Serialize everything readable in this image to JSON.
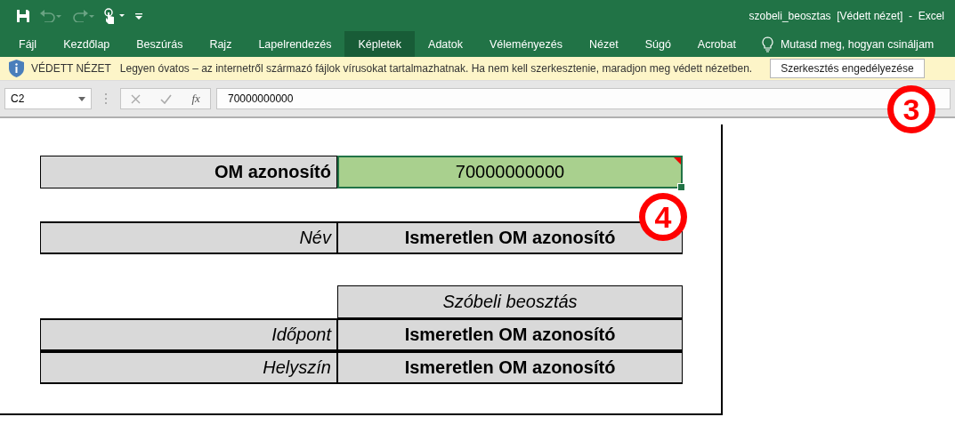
{
  "window": {
    "title": "szobeli_beosztas  [Védett nézet]  -  Excel"
  },
  "tabs": [
    {
      "label": "Fájl",
      "selected": false
    },
    {
      "label": "Kezdőlap",
      "selected": false
    },
    {
      "label": "Beszúrás",
      "selected": false
    },
    {
      "label": "Rajz",
      "selected": false
    },
    {
      "label": "Lapelrendezés",
      "selected": false
    },
    {
      "label": "Képletek",
      "selected": true
    },
    {
      "label": "Adatok",
      "selected": false
    },
    {
      "label": "Véleményezés",
      "selected": false
    },
    {
      "label": "Nézet",
      "selected": false
    },
    {
      "label": "Súgó",
      "selected": false
    },
    {
      "label": "Acrobat",
      "selected": false
    }
  ],
  "tell_me": "Mutasd meg, hogyan csináljam",
  "protected_bar": {
    "label": "VÉDETT NÉZET",
    "message": "Legyen óvatos – az internetről származó fájlok vírusokat tartalmazhatnak. Ha nem kell szerkesztenie, maradjon meg védett nézetben.",
    "button": "Szerkesztés engedélyezése"
  },
  "formula_bar": {
    "name_box": "C2",
    "function_button": "fx",
    "value": "70000000000"
  },
  "sheet": {
    "om": {
      "label": "OM azonosító",
      "value": "70000000000",
      "selected": true,
      "has_comment": true
    },
    "name": {
      "label": "Név",
      "value": "Ismeretlen OM azonosító"
    },
    "schedule": {
      "heading": "Szóbeli beosztás",
      "rows": [
        {
          "label": "Időpont",
          "value": "Ismeretlen OM azonosító"
        },
        {
          "label": "Helyszín",
          "value": "Ismeretlen OM azonosító"
        }
      ]
    }
  },
  "callouts": [
    {
      "number": "3"
    },
    {
      "number": "4"
    }
  ]
}
